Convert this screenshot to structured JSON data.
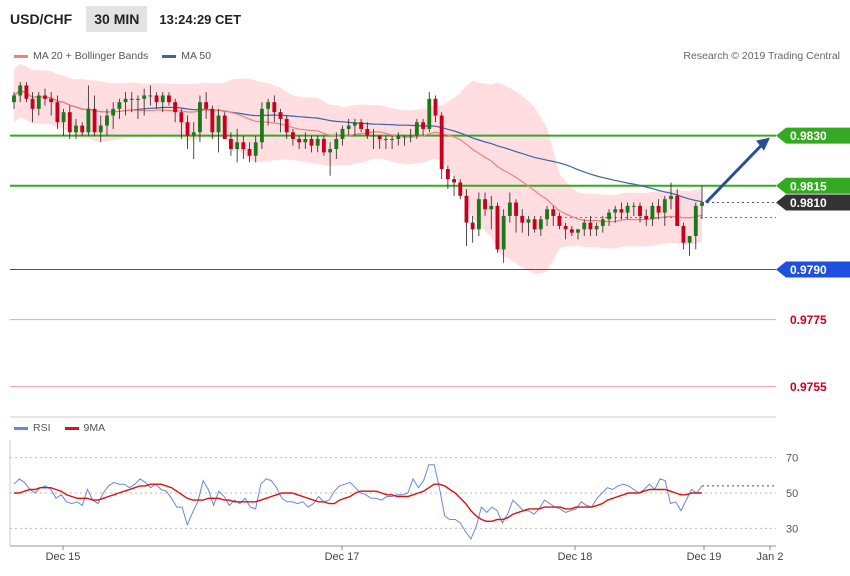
{
  "header": {
    "symbol": "USD/CHF",
    "timeframe": "30 MIN",
    "clock": "13:24:29 CET"
  },
  "legend": {
    "ma20_label": "MA 20 + Bollinger Bands",
    "ma50_label": "MA 50",
    "rsi_label": "RSI",
    "rsi_ma_label": "9MA"
  },
  "credit": "Research © 2019 Trading Central",
  "colors": {
    "candle_up": "#1a7a1a",
    "candle_down": "#c8001e",
    "ma20": "#f08080",
    "bollinger_fill": "#ffdde0",
    "ma50": "#3a66a8",
    "resistance": "#33aa22",
    "support": "#1f4fe0",
    "lower_levels": "#f0a0a0",
    "current": "#333333",
    "rsi": "#6688dd",
    "rsi_ma": "#dd1111",
    "arrow": "#2c4c96"
  },
  "chart_data": [
    {
      "type": "candlestick",
      "title": "",
      "y_range": [
        0.9748,
        0.9852
      ],
      "levels": [
        {
          "value": 0.983,
          "label": "0.9830",
          "kind": "resistance"
        },
        {
          "value": 0.9815,
          "label": "0.9815",
          "kind": "resistance"
        },
        {
          "value": 0.981,
          "label": "0.9810",
          "kind": "current"
        },
        {
          "value": 0.979,
          "label": "0.9790",
          "kind": "support"
        },
        {
          "value": 0.9775,
          "label": "0.9775",
          "kind": "lower"
        },
        {
          "value": 0.9755,
          "label": "0.9755",
          "kind": "lower"
        }
      ],
      "projection": {
        "from": 0.981,
        "to": 0.983
      },
      "x_labels": [
        "Dec 15",
        "Dec 17",
        "Dec 18",
        "Dec 19",
        "Jan 2"
      ],
      "candles": [
        [
          0.984,
          0.9843,
          0.9838,
          0.9842
        ],
        [
          0.9842,
          0.9846,
          0.984,
          0.9845
        ],
        [
          0.9845,
          0.9846,
          0.984,
          0.9841
        ],
        [
          0.9841,
          0.9843,
          0.9834,
          0.9838
        ],
        [
          0.9838,
          0.9843,
          0.9836,
          0.9842
        ],
        [
          0.9842,
          0.9844,
          0.9839,
          0.9841
        ],
        [
          0.9841,
          0.9843,
          0.9836,
          0.984
        ],
        [
          0.984,
          0.9842,
          0.9832,
          0.9834
        ],
        [
          0.9834,
          0.9838,
          0.983,
          0.9837
        ],
        [
          0.9837,
          0.9839,
          0.9829,
          0.9831
        ],
        [
          0.9831,
          0.9835,
          0.9829,
          0.9833
        ],
        [
          0.9833,
          0.9834,
          0.983,
          0.9831
        ],
        [
          0.9831,
          0.9845,
          0.983,
          0.9838
        ],
        [
          0.9838,
          0.9842,
          0.983,
          0.9831
        ],
        [
          0.9831,
          0.9836,
          0.9828,
          0.9833
        ],
        [
          0.9833,
          0.9838,
          0.983,
          0.9836
        ],
        [
          0.9836,
          0.984,
          0.9832,
          0.9838
        ],
        [
          0.9838,
          0.9841,
          0.9835,
          0.984
        ],
        [
          0.984,
          0.9843,
          0.9836,
          0.9841
        ],
        [
          0.9841,
          0.9843,
          0.9837,
          0.9841
        ],
        [
          0.9841,
          0.9842,
          0.9835,
          0.9841
        ],
        [
          0.9841,
          0.9844,
          0.9836,
          0.9842
        ],
        [
          0.9842,
          0.9845,
          0.9839,
          0.9842
        ],
        [
          0.9842,
          0.9843,
          0.9838,
          0.984
        ],
        [
          0.984,
          0.9843,
          0.9837,
          0.9842
        ],
        [
          0.9842,
          0.9843,
          0.9839,
          0.984
        ],
        [
          0.984,
          0.9841,
          0.9834,
          0.9837
        ],
        [
          0.9837,
          0.9838,
          0.9829,
          0.9834
        ],
        [
          0.9834,
          0.9836,
          0.9826,
          0.983
        ],
        [
          0.983,
          0.9834,
          0.9823,
          0.9831
        ],
        [
          0.9831,
          0.9842,
          0.9828,
          0.984
        ],
        [
          0.984,
          0.9843,
          0.9835,
          0.9838
        ],
        [
          0.9838,
          0.9839,
          0.9829,
          0.9831
        ],
        [
          0.9831,
          0.9838,
          0.9825,
          0.9836
        ],
        [
          0.9836,
          0.9837,
          0.9829,
          0.9829
        ],
        [
          0.9829,
          0.9831,
          0.9824,
          0.9826
        ],
        [
          0.9826,
          0.9832,
          0.9822,
          0.9828
        ],
        [
          0.9828,
          0.983,
          0.9823,
          0.9826
        ],
        [
          0.9826,
          0.9828,
          0.9822,
          0.9824
        ],
        [
          0.9824,
          0.983,
          0.9822,
          0.9828
        ],
        [
          0.9828,
          0.984,
          0.9826,
          0.9838
        ],
        [
          0.9838,
          0.9841,
          0.9833,
          0.984
        ],
        [
          0.984,
          0.9842,
          0.9834,
          0.9837
        ],
        [
          0.9837,
          0.9838,
          0.9831,
          0.9835
        ],
        [
          0.9835,
          0.9836,
          0.9829,
          0.9831
        ],
        [
          0.9831,
          0.9832,
          0.9827,
          0.9829
        ],
        [
          0.9829,
          0.983,
          0.9826,
          0.9828
        ],
        [
          0.9828,
          0.9831,
          0.9826,
          0.9829
        ],
        [
          0.9829,
          0.983,
          0.9825,
          0.9827
        ],
        [
          0.9827,
          0.983,
          0.9825,
          0.9829
        ],
        [
          0.9829,
          0.983,
          0.9824,
          0.9825
        ],
        [
          0.9825,
          0.9828,
          0.9818,
          0.9826
        ],
        [
          0.9826,
          0.9831,
          0.9823,
          0.9829
        ],
        [
          0.9829,
          0.9833,
          0.9827,
          0.9832
        ],
        [
          0.9832,
          0.9835,
          0.983,
          0.9833
        ],
        [
          0.9833,
          0.9835,
          0.983,
          0.9834
        ],
        [
          0.9834,
          0.9835,
          0.9831,
          0.9832
        ],
        [
          0.9832,
          0.9834,
          0.9829,
          0.983
        ],
        [
          0.983,
          0.9832,
          0.9826,
          0.983
        ],
        [
          0.983,
          0.983,
          0.9826,
          0.9829
        ],
        [
          0.9829,
          0.983,
          0.9826,
          0.9829
        ],
        [
          0.9829,
          0.983,
          0.9826,
          0.9829
        ],
        [
          0.9829,
          0.9831,
          0.9827,
          0.983
        ],
        [
          0.983,
          0.983,
          0.9827,
          0.983
        ],
        [
          0.983,
          0.9832,
          0.9828,
          0.983
        ],
        [
          0.983,
          0.9835,
          0.9829,
          0.9834
        ],
        [
          0.9834,
          0.9835,
          0.983,
          0.9832
        ],
        [
          0.9832,
          0.9843,
          0.9831,
          0.9841
        ],
        [
          0.9841,
          0.9842,
          0.9834,
          0.9836
        ],
        [
          0.9836,
          0.9837,
          0.9817,
          0.982
        ],
        [
          0.982,
          0.9821,
          0.9814,
          0.9817
        ],
        [
          0.9817,
          0.9818,
          0.9812,
          0.9816
        ],
        [
          0.9816,
          0.9817,
          0.9811,
          0.9812
        ],
        [
          0.9812,
          0.9814,
          0.9797,
          0.9804
        ],
        [
          0.9804,
          0.9806,
          0.9798,
          0.9802
        ],
        [
          0.9802,
          0.9813,
          0.98,
          0.9811
        ],
        [
          0.9811,
          0.9813,
          0.9806,
          0.9808
        ],
        [
          0.9808,
          0.9812,
          0.9802,
          0.9809
        ],
        [
          0.9809,
          0.981,
          0.9795,
          0.9796
        ],
        [
          0.9796,
          0.9808,
          0.9792,
          0.9806
        ],
        [
          0.9806,
          0.9813,
          0.9804,
          0.981
        ],
        [
          0.981,
          0.9811,
          0.9801,
          0.9806
        ],
        [
          0.9806,
          0.9808,
          0.9801,
          0.9804
        ],
        [
          0.9804,
          0.9806,
          0.98,
          0.9805
        ],
        [
          0.9805,
          0.9806,
          0.9801,
          0.9802
        ],
        [
          0.9802,
          0.9806,
          0.98,
          0.9805
        ],
        [
          0.9805,
          0.9809,
          0.9803,
          0.9808
        ],
        [
          0.9808,
          0.9809,
          0.9803,
          0.9806
        ],
        [
          0.9806,
          0.9807,
          0.9802,
          0.9803
        ],
        [
          0.9803,
          0.9804,
          0.9799,
          0.9802
        ],
        [
          0.9802,
          0.9803,
          0.98,
          0.9801
        ],
        [
          0.9801,
          0.9802,
          0.9799,
          0.9802
        ],
        [
          0.9802,
          0.9805,
          0.98,
          0.9804
        ],
        [
          0.9804,
          0.9806,
          0.98,
          0.9802
        ],
        [
          0.9802,
          0.9804,
          0.98,
          0.9803
        ],
        [
          0.9803,
          0.9806,
          0.9801,
          0.9805
        ],
        [
          0.9805,
          0.9808,
          0.9803,
          0.9807
        ],
        [
          0.9807,
          0.9809,
          0.9804,
          0.9808
        ],
        [
          0.9808,
          0.981,
          0.9805,
          0.9807
        ],
        [
          0.9807,
          0.981,
          0.9805,
          0.9809
        ],
        [
          0.9809,
          0.981,
          0.9806,
          0.9809
        ],
        [
          0.9809,
          0.981,
          0.9804,
          0.9806
        ],
        [
          0.9806,
          0.9808,
          0.9803,
          0.9805
        ],
        [
          0.9805,
          0.981,
          0.9803,
          0.9809
        ],
        [
          0.9809,
          0.9811,
          0.9805,
          0.9807
        ],
        [
          0.9807,
          0.9812,
          0.9803,
          0.9811
        ],
        [
          0.9811,
          0.9816,
          0.9808,
          0.9812
        ],
        [
          0.9812,
          0.9814,
          0.9803,
          0.9803
        ],
        [
          0.9803,
          0.9804,
          0.9796,
          0.9798
        ],
        [
          0.9798,
          0.98,
          0.9794,
          0.98
        ],
        [
          0.98,
          0.981,
          0.9796,
          0.9809
        ],
        [
          0.9809,
          0.9815,
          0.9805,
          0.981
        ]
      ]
    },
    {
      "type": "line",
      "title": "RSI",
      "y_range": [
        20,
        80
      ],
      "y_ticks": [
        30,
        50,
        70
      ],
      "series": [
        {
          "name": "RSI",
          "values": [
            55,
            58,
            56,
            52,
            50,
            53,
            54,
            52,
            47,
            49,
            45,
            44,
            45,
            43,
            52,
            46,
            44,
            50,
            54,
            56,
            55,
            55,
            53,
            55,
            58,
            56,
            53,
            55,
            52,
            51,
            47,
            42,
            42,
            32,
            39,
            45,
            57,
            52,
            43,
            51,
            48,
            43,
            46,
            44,
            47,
            42,
            41,
            55,
            58,
            57,
            53,
            47,
            45,
            45,
            44,
            45,
            42,
            44,
            48,
            45,
            46,
            51,
            54,
            55,
            56,
            53,
            50,
            49,
            47,
            47,
            46,
            48,
            48,
            49,
            49,
            50,
            58,
            53,
            57,
            66,
            66,
            53,
            37,
            35,
            35,
            33,
            28,
            24,
            31,
            42,
            39,
            42,
            40,
            33,
            38,
            46,
            43,
            40,
            40,
            38,
            41,
            46,
            44,
            42,
            41,
            39,
            40,
            41,
            45,
            43,
            42,
            47,
            50,
            53,
            52,
            54,
            55,
            54,
            52,
            50,
            52,
            55,
            52,
            58,
            57,
            44,
            45,
            40,
            46,
            52,
            50,
            54
          ]
        },
        {
          "name": "9MA",
          "values": [
            50,
            50,
            51,
            52,
            52,
            53,
            53,
            53,
            52,
            51,
            49,
            48,
            47,
            47,
            47,
            46,
            46,
            47,
            48,
            49,
            50,
            51,
            52,
            53,
            54,
            54,
            55,
            55,
            55,
            54,
            53,
            51,
            49,
            47,
            46,
            46,
            46,
            47,
            47,
            47,
            46,
            46,
            45,
            45,
            45,
            45,
            45,
            46,
            47,
            48,
            49,
            50,
            50,
            50,
            49,
            48,
            47,
            46,
            45,
            45,
            44,
            44,
            46,
            47,
            48,
            50,
            51,
            51,
            51,
            51,
            50,
            49,
            49,
            48,
            48,
            48,
            49,
            50,
            51,
            53,
            55,
            55,
            54,
            52,
            50,
            47,
            44,
            40,
            37,
            35,
            34,
            34,
            35,
            35,
            36,
            38,
            39,
            40,
            41,
            41,
            41,
            42,
            42,
            42,
            42,
            41,
            41,
            42,
            42,
            42,
            42,
            43,
            44,
            46,
            47,
            48,
            49,
            50,
            50,
            50,
            51,
            52,
            52,
            52,
            52,
            51,
            50,
            49,
            49,
            50,
            50,
            50
          ]
        }
      ],
      "x_labels": [
        "Dec 15",
        "Dec 17",
        "Dec 18",
        "Dec 19",
        "Jan 2"
      ]
    }
  ]
}
